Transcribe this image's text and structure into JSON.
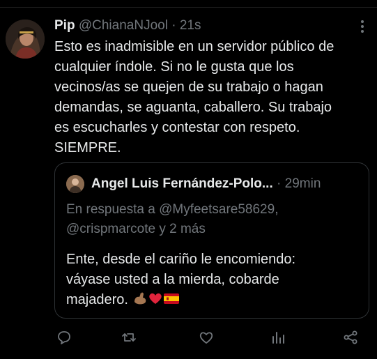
{
  "tweet": {
    "display_name": "Pip",
    "handle": "@ChianaNJool",
    "separator": "·",
    "time": "21s",
    "text": "Esto es inadmisible en un servidor público de\ncualquier índole. Si no le gusta que los\nvecinos/as se quejen de su trabajo o hagan\ndemandas, se aguanta, caballero. Su trabajo\nes escucharles y contestar con respeto.\nSIEMPRE."
  },
  "quote": {
    "display_name": "Angel Luis Fernández-Polo...",
    "separator": "·",
    "time": "29min",
    "reply_prefix": "En respuesta a ",
    "reply_to_1": "@Myfeetsare58629",
    "reply_sep": ",",
    "reply_to_2": "@crispmarcote",
    "reply_suffix": " y 2 más",
    "text": "Ente, desde el cariño le encomiendo:\nváyase usted a la mierda, cobarde\nmajadero.",
    "emojis": [
      "flexed-biceps-emoji",
      "red-heart-emoji",
      "spain-flag-emoji"
    ]
  },
  "icons": {
    "more": "more-icon",
    "reply": "reply-icon",
    "retweet": "retweet-icon",
    "like": "like-icon",
    "views": "views-icon",
    "share": "share-icon"
  },
  "colors": {
    "background": "#000000",
    "text": "#e7e9ea",
    "muted": "#71767b",
    "border": "#2f3336"
  }
}
